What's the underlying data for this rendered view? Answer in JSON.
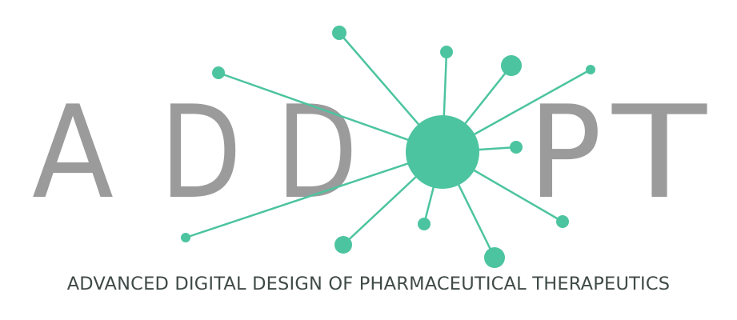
{
  "logo": {
    "letters": [
      "A",
      "D",
      "D",
      "P",
      "T"
    ],
    "tagline": "ADVANCED DIGITAL DESIGN OF PHARMACEUTICAL THERAPEUTICS",
    "colors": {
      "accent": "#4cc49f",
      "letters": "#9a9b9a",
      "tagline": "#3f4a47",
      "background": "#ffffff"
    },
    "icon": "molecule-network-icon"
  }
}
